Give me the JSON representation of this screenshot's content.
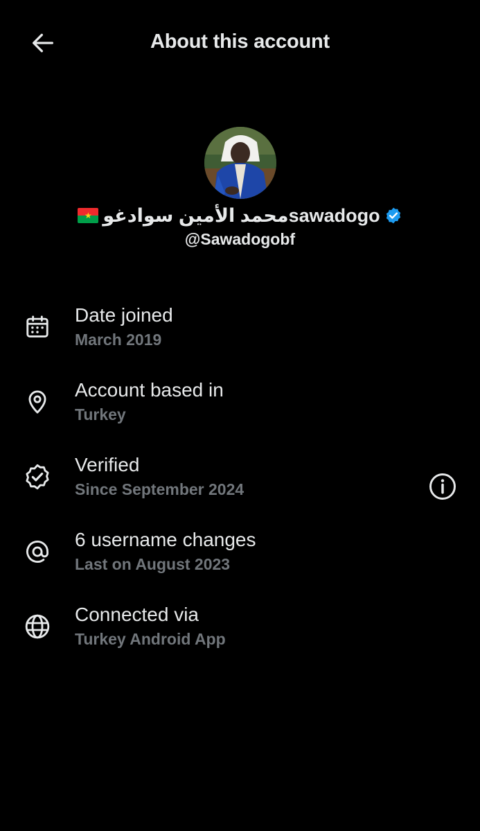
{
  "header": {
    "title": "About this account"
  },
  "profile": {
    "display_name": "محمد الأمين سوادغوsawadogo",
    "flag": "Burkina Faso flag",
    "handle": "@Sawadogobf",
    "verified_badge_color": "#1d9bf0"
  },
  "details": [
    {
      "icon": "calendar-icon",
      "label": "Date joined",
      "value": "March 2019"
    },
    {
      "icon": "location-pin-icon",
      "label": "Account based in",
      "value": "Turkey"
    },
    {
      "icon": "verified-badge-icon",
      "label": "Verified",
      "value": "Since September 2024"
    },
    {
      "icon": "at-sign-icon",
      "label": "6 username changes",
      "value": "Last on August 2023"
    },
    {
      "icon": "globe-icon",
      "label": "Connected via",
      "value": "Turkey Android App"
    }
  ],
  "colors": {
    "background": "#000000",
    "primary_text": "#e7e9ea",
    "secondary_text": "#71767b",
    "accent": "#1d9bf0"
  }
}
